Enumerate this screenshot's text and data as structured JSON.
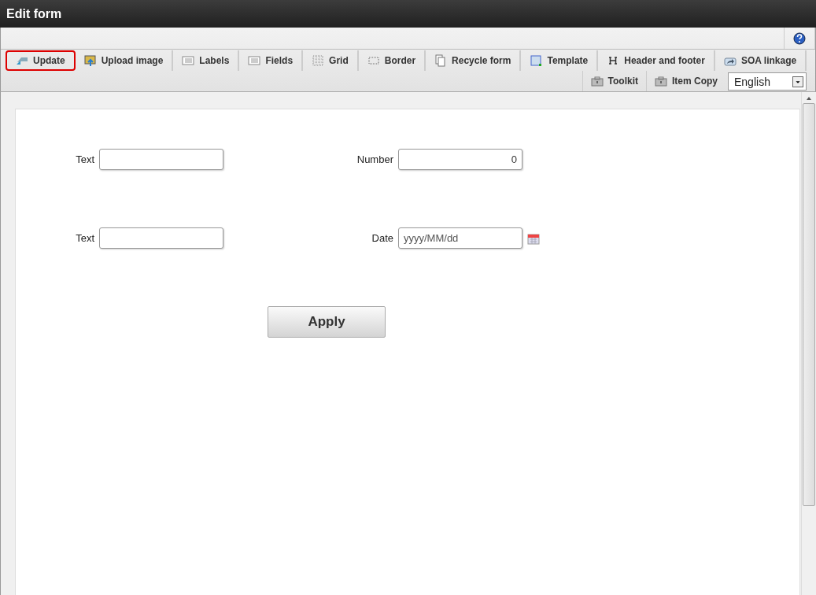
{
  "window": {
    "title": "Edit form"
  },
  "toolbar": {
    "tools": [
      {
        "label": "Update",
        "selected": true
      },
      {
        "label": "Upload image",
        "selected": false
      },
      {
        "label": "Labels",
        "selected": false
      },
      {
        "label": "Fields",
        "selected": false
      },
      {
        "label": "Grid",
        "selected": false
      },
      {
        "label": "Border",
        "selected": false
      },
      {
        "label": "Recycle form",
        "selected": false
      },
      {
        "label": "Template",
        "selected": false
      },
      {
        "label": "Header and footer",
        "selected": false
      },
      {
        "label": "SOA linkage",
        "selected": false
      }
    ],
    "secondary": [
      {
        "label": "Toolkit"
      },
      {
        "label": "Item Copy"
      }
    ],
    "language": {
      "value": "English"
    }
  },
  "form": {
    "rows": [
      [
        {
          "label": "Text",
          "kind": "text"
        },
        {
          "label": "Number",
          "value": "0",
          "kind": "number"
        }
      ],
      [
        {
          "label": "Text",
          "kind": "text"
        },
        {
          "label": "Date",
          "placeholder": "yyyy/MM/dd",
          "kind": "date"
        }
      ]
    ],
    "apply": "Apply"
  }
}
